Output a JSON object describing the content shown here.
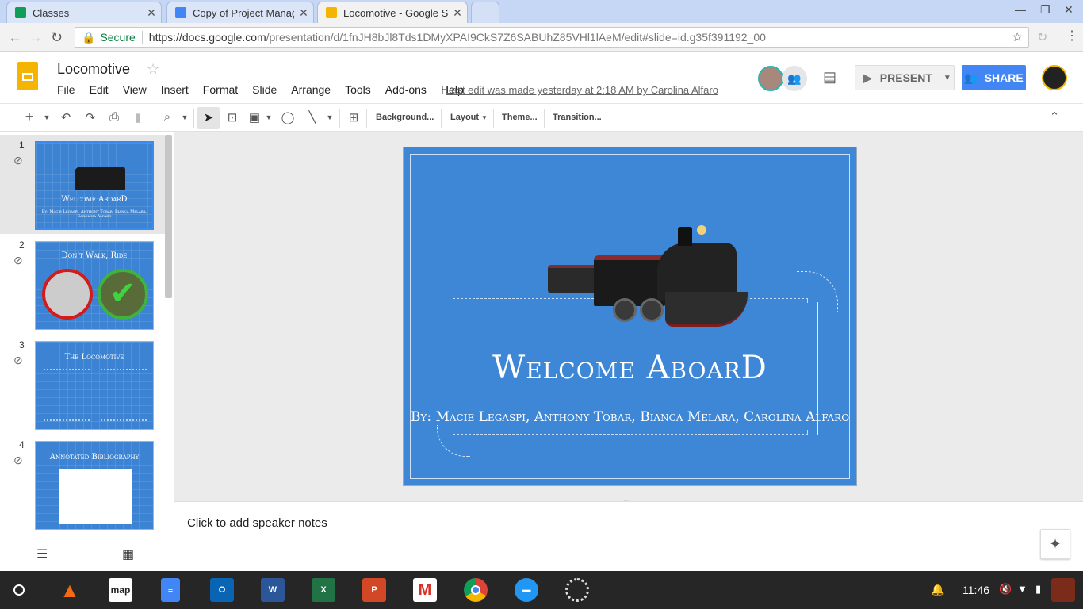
{
  "browser": {
    "tabs": [
      {
        "label": "Classes",
        "icon": "google-classroom-icon",
        "color": "#0f9d58"
      },
      {
        "label": "Copy of Project Manager",
        "icon": "google-docs-icon",
        "color": "#4285f4"
      },
      {
        "label": "Locomotive - Google Slid",
        "icon": "google-slides-icon",
        "color": "#f4b400"
      }
    ],
    "secure_label": "Secure",
    "url_host": "https://docs.google.com",
    "url_path": "/presentation/d/1fnJH8bJl8Tds1DMyXPAI9CkS7Z6SABUhZ85VHl1lAeM/edit#slide=id.g35f391192_00"
  },
  "doc": {
    "title": "Locomotive",
    "menus": [
      "File",
      "Edit",
      "View",
      "Insert",
      "Format",
      "Slide",
      "Arrange",
      "Tools",
      "Add-ons",
      "Help"
    ],
    "last_edit": "Last edit was made yesterday at 2:18 AM by Carolina Alfaro",
    "present_label": "PRESENT",
    "share_label": "SHARE"
  },
  "toolbar": {
    "background": "Background...",
    "layout": "Layout",
    "theme": "Theme...",
    "transition": "Transition..."
  },
  "slides": [
    {
      "num": "1",
      "title": "Welcome AboarD",
      "sub": "By: Macie Legaspi, Anthony Tobar, Bianca Melara, Carolina Alfaro"
    },
    {
      "num": "2",
      "title": "Don't Walk, Ride"
    },
    {
      "num": "3",
      "title": "The Locomotive"
    },
    {
      "num": "4",
      "title": "Annotated Bibliography"
    }
  ],
  "current_slide": {
    "title": "Welcome AboarD",
    "subtitle": "By: Macie Legaspi, Anthony Tobar, Bianca Melara, Carolina Alfaro"
  },
  "notes_placeholder": "Click to add speaker notes",
  "taskbar": {
    "apps": [
      "launcher-icon",
      "vlc-icon",
      "map-icon",
      "google-docs-icon",
      "outlook-icon",
      "word-icon",
      "excel-icon",
      "powerpoint-icon",
      "gmail-icon",
      "chrome-icon",
      "files-icon",
      "loading-icon"
    ],
    "map_label": "map",
    "clock": "11:46"
  },
  "colors": {
    "slide_blue": "#3d87d6",
    "share_blue": "#4285f4",
    "secure_green": "#0b8043"
  }
}
